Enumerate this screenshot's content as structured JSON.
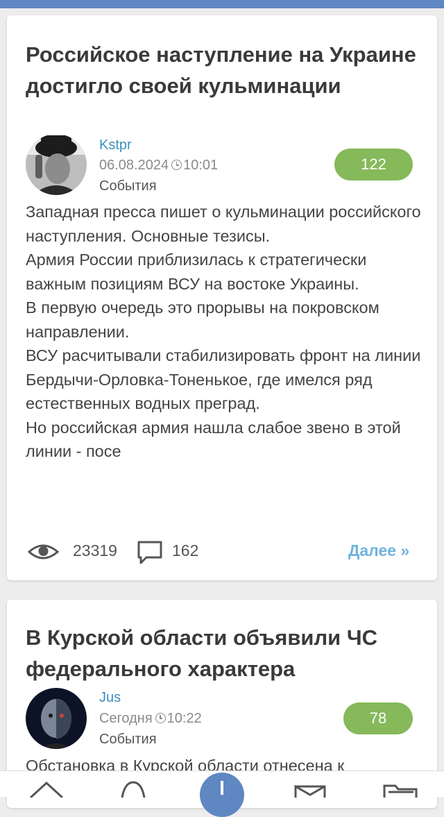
{
  "colors": {
    "accent": "#5f87c2",
    "badge": "#85b95a",
    "author_link": "#3a8fbd",
    "more_link": "#6fb3dc"
  },
  "posts": [
    {
      "title": "Российское наступление на Украине достигло своей кульминации",
      "author": "Kstpr",
      "date": "06.08.2024",
      "time": "10:01",
      "category": "События",
      "rating": "122",
      "body": "Западная пресса пишет о кульминации российского наступления. Основные тезисы.\nАрмия России приблизилась к стратегически важным позициям ВСУ на востоке Украины.\nВ первую очередь это прорывы на покровском направлении.\nВСУ расчитывали стабилизировать  фронт на линии Бердычи-Орловка-Тоненькое, где имелся ряд естественных водных преград.\nНо российская армия нашла слабое звено в этой линии - посе",
      "views": "23319",
      "comments": "162",
      "more_label": "Далее »"
    },
    {
      "title": "В Курской области объявили ЧС федерального характера",
      "author": "Jus",
      "date": "Сегодня",
      "time": "10:22",
      "category": "События",
      "rating": "78",
      "body": "Обстановка в Курской области отнесена к"
    }
  ],
  "icons": {
    "views": "eye-icon",
    "comments": "comment-icon",
    "time": "clock-icon",
    "nav": [
      "home-icon",
      "egg-icon",
      "add-icon",
      "mail-icon",
      "folder-icon"
    ]
  }
}
